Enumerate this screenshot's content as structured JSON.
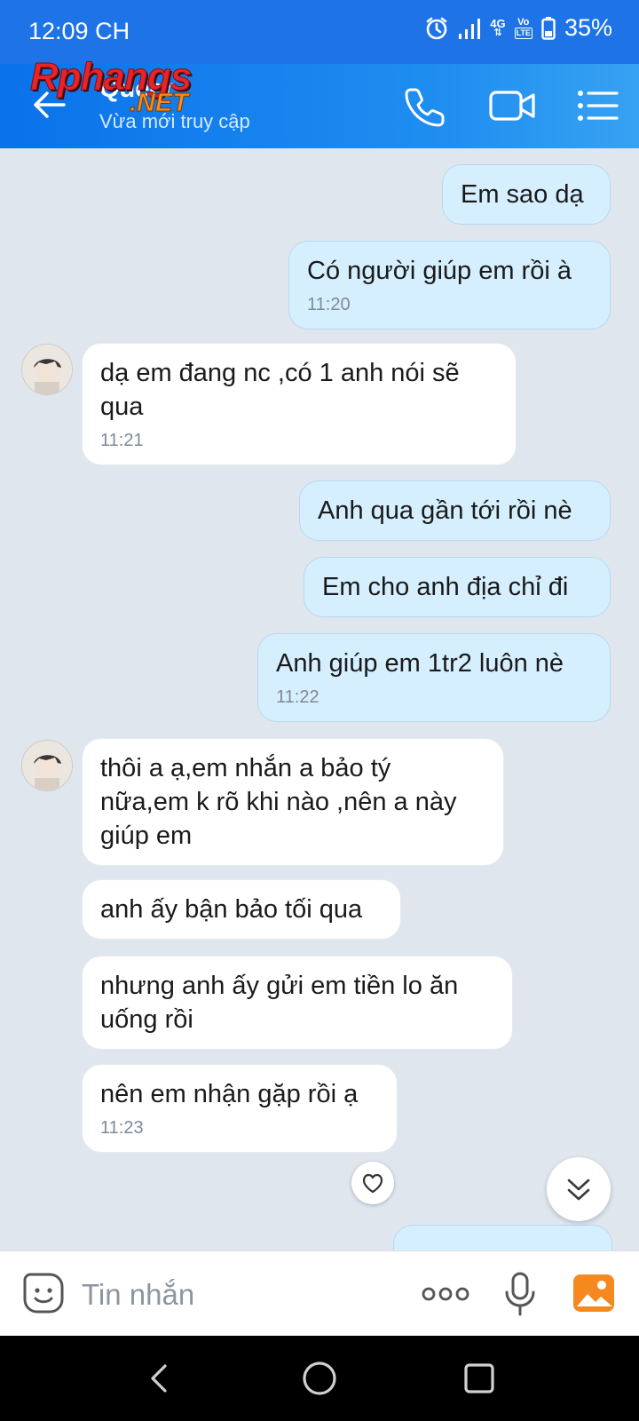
{
  "status_bar": {
    "time": "12:09 CH",
    "network": "4G",
    "volte_top": "Vo",
    "volte_bottom": "LTE",
    "battery": "35%"
  },
  "watermark": {
    "line1": "Rphangs",
    "line2": ".NET"
  },
  "header": {
    "contact_name": "Queer",
    "contact_status": "Vừa mới truy cập"
  },
  "messages": [
    {
      "text": "Em sao dạ",
      "time": ""
    },
    {
      "text": "Có người giúp em rồi à",
      "time": "11:20"
    },
    {
      "text": "dạ em đang nc ,có 1 anh nói sẽ qua",
      "time": "11:21"
    },
    {
      "text": "Anh qua gần tới rồi nè",
      "time": ""
    },
    {
      "text": "Em cho anh địa chỉ đi",
      "time": ""
    },
    {
      "text": "Anh giúp em 1tr2 luôn nè",
      "time": "11:22"
    },
    {
      "text": "thôi a ạ,em nhắn a bảo tý nữa,em k rõ khi nào ,nên a này giúp em",
      "time": ""
    },
    {
      "text": "anh ấy bận bảo tối qua",
      "time": ""
    },
    {
      "text": "nhưng anh ấy gửi em tiền lo ăn uống rồi",
      "time": ""
    },
    {
      "text": "nên em nhận gặp rồi ạ",
      "time": "11:23"
    }
  ],
  "input": {
    "placeholder": "Tin nhắn"
  },
  "icons": {
    "header": [
      "back-arrow-icon",
      "phone-icon",
      "video-call-icon",
      "menu-list-icon"
    ],
    "input": [
      "sticker-icon",
      "more-dots-icon",
      "microphone-icon",
      "image-icon"
    ],
    "nav": [
      "nav-back-icon",
      "nav-home-icon",
      "nav-recents-icon"
    ]
  },
  "colors": {
    "header": "#1e74e6",
    "outgoing_bubble": "#d6efff",
    "incoming_bubble": "#ffffff",
    "chat_background": "#dfe6ee"
  }
}
